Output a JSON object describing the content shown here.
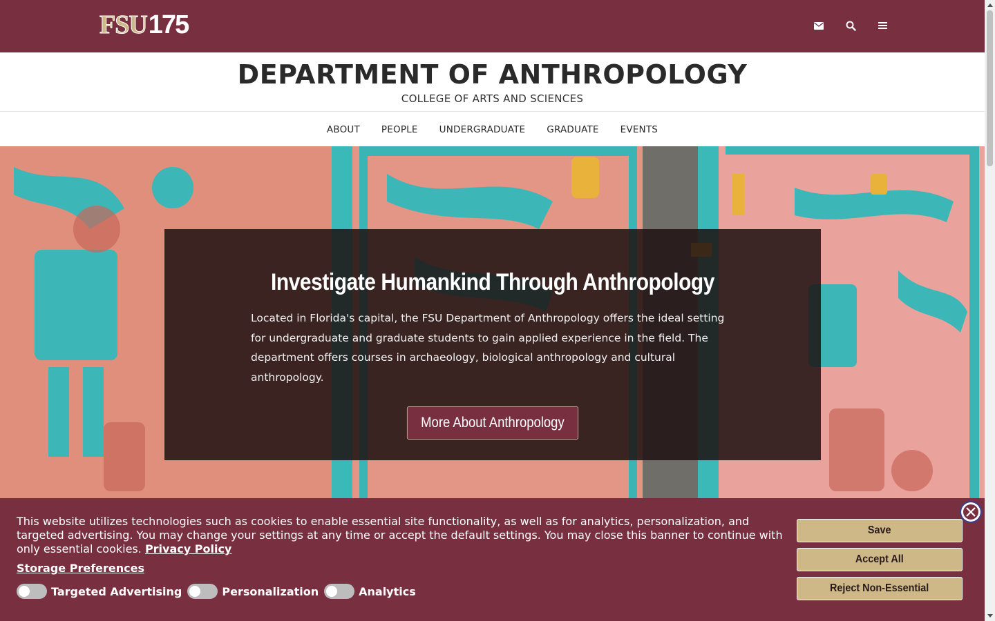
{
  "topbar": {
    "logo_fsu": "FSU",
    "logo_years": "175",
    "icons": [
      "envelope-icon",
      "search-icon",
      "menu-icon"
    ]
  },
  "header": {
    "title": "DEPARTMENT OF ANTHROPOLOGY",
    "subtitle": "COLLEGE OF ARTS AND SCIENCES"
  },
  "nav": {
    "items": [
      {
        "label": "ABOUT"
      },
      {
        "label": "PEOPLE"
      },
      {
        "label": "UNDERGRADUATE"
      },
      {
        "label": "GRADUATE"
      },
      {
        "label": "EVENTS"
      }
    ]
  },
  "hero": {
    "title": "Investigate Humankind Through Anthropology",
    "text": "Located in Florida's capital, the FSU Department of Anthropology offers the ideal setting for undergraduate and graduate students to gain applied experience in the field. The department offers courses in archaeology, biological anthropology and cultural anthropology.",
    "button": "More About Anthropology"
  },
  "cookie": {
    "text": "This website utilizes technologies such as cookies to enable essential site functionality, as well as for analytics, personalization, and targeted advertising. You may change your settings at any time or accept the default settings. You may close this banner to continue with only essential cookies.",
    "privacy_link": "Privacy Policy",
    "storage_link": "Storage Preferences",
    "toggles": [
      {
        "label": "Targeted Advertising",
        "on": false
      },
      {
        "label": "Personalization",
        "on": false
      },
      {
        "label": "Analytics",
        "on": false
      }
    ],
    "save": "Save",
    "accept_all": "Accept All",
    "reject": "Reject Non-Essential"
  },
  "colors": {
    "garnet": "#782f40",
    "gold": "#ceb888"
  }
}
